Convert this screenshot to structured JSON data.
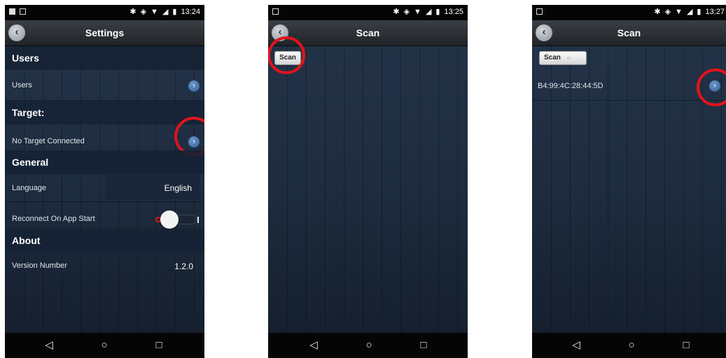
{
  "colors": {
    "annotation_red": "#e3131b",
    "chevron_blue": "#3f6ea8",
    "background_navy": "#1f2d40"
  },
  "screens": [
    {
      "status": {
        "time": "13:24",
        "icons": [
          "bluetooth-icon",
          "vibrate-icon",
          "wifi-icon",
          "signal-icon",
          "battery-icon"
        ]
      },
      "title": "Settings",
      "sections": {
        "users": {
          "header": "Users",
          "row_label": "Users"
        },
        "target": {
          "header": "Target:",
          "row_label": "No Target Connected"
        },
        "general": {
          "header": "General",
          "language_label": "Language",
          "language_value": "English",
          "reconnect_label": "Reconnect On App Start",
          "reconnect_on": false
        },
        "about": {
          "header": "About",
          "version_label": "Version Number",
          "version_value": "1.2.0"
        }
      }
    },
    {
      "status": {
        "time": "13:25"
      },
      "title": "Scan",
      "scan_label": "Scan"
    },
    {
      "status": {
        "time": "13:27"
      },
      "title": "Scan",
      "scan_label": "Scan",
      "devices": [
        {
          "address": "B4:99:4C:28:44:5D"
        }
      ]
    }
  ],
  "navbar": {
    "back": "◁",
    "home": "○",
    "recents": "□"
  },
  "glyphs": {
    "bluetooth": "✱",
    "vibrate": "◈",
    "wifi": "▼",
    "signal": "◢",
    "battery": "▮",
    "back_arrow": "‹",
    "chevron": "›",
    "spinner": "‹›"
  }
}
